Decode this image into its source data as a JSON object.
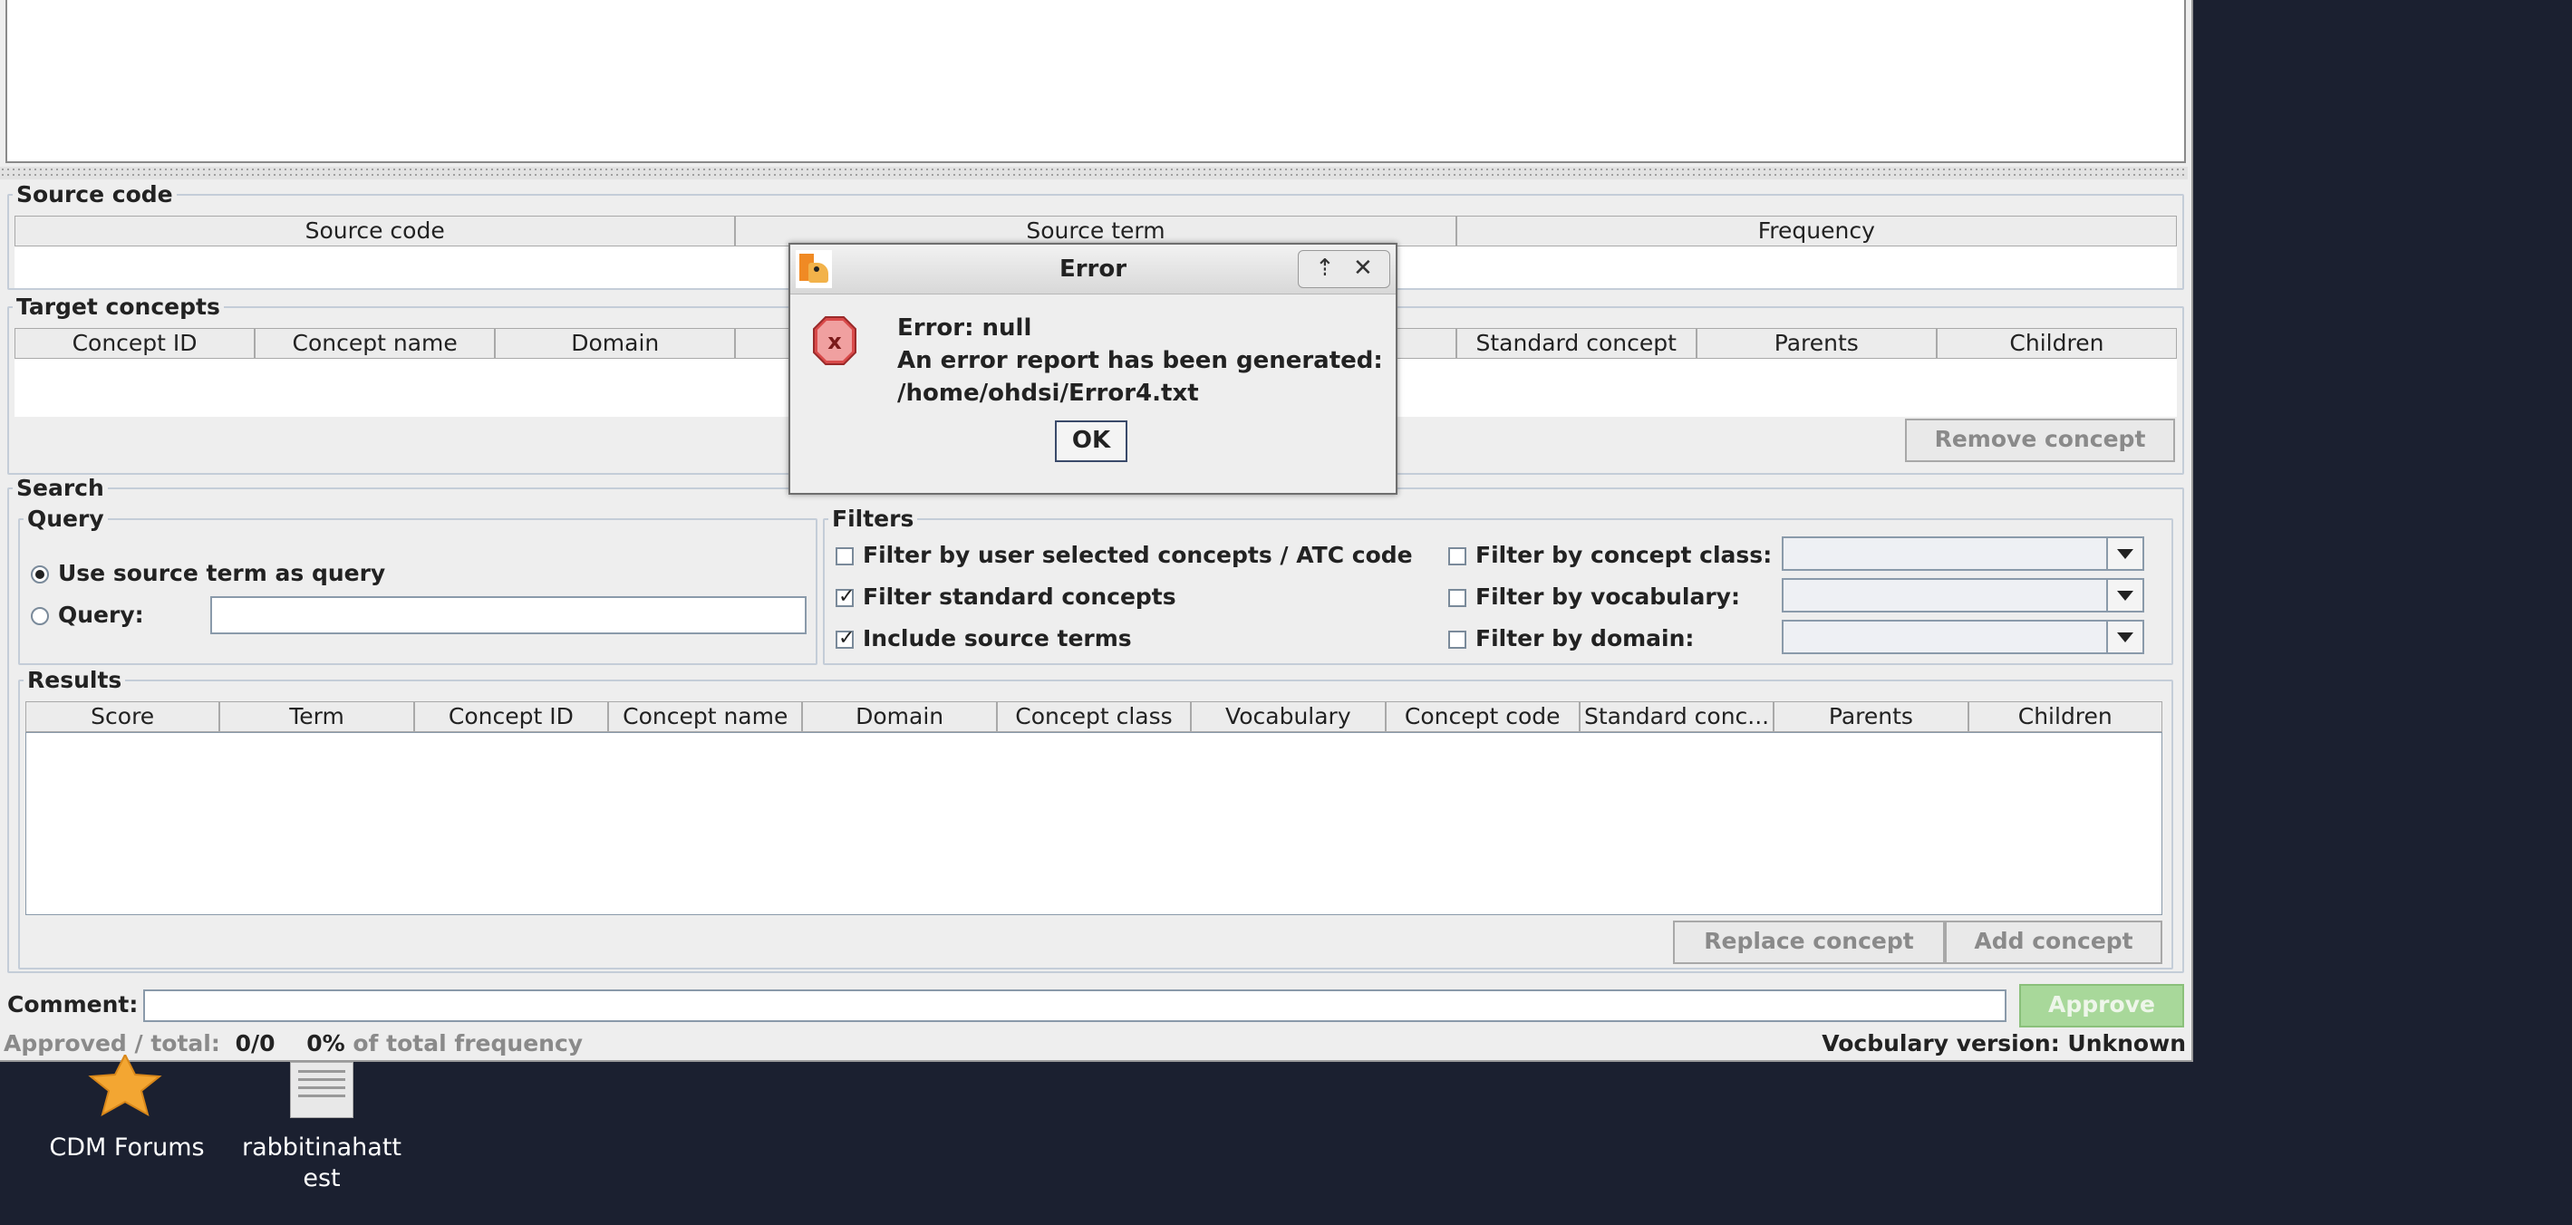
{
  "source_code": {
    "title": "Source code",
    "columns": [
      "Source code",
      "Source term",
      "Frequency"
    ]
  },
  "target_concepts": {
    "title": "Target concepts",
    "columns": [
      "Concept ID",
      "Concept name",
      "Domain",
      "C",
      "",
      "de",
      "Standard concept",
      "Parents",
      "Children"
    ],
    "remove_button": "Remove concept"
  },
  "search": {
    "title": "Search",
    "query": {
      "title": "Query",
      "use_source_label": "Use source term as query",
      "query_label": "Query:",
      "query_value": ""
    },
    "filters": {
      "title": "Filters",
      "user_selected": "Filter by user selected concepts / ATC code",
      "standard": "Filter standard concepts",
      "include_source": "Include source terms",
      "concept_class": "Filter by concept class:",
      "vocabulary": "Filter by vocabulary:",
      "domain": "Filter by domain:"
    },
    "results": {
      "title": "Results",
      "columns": [
        "Score",
        "Term",
        "Concept ID",
        "Concept name",
        "Domain",
        "Concept class",
        "Vocabulary",
        "Concept code",
        "Standard conc...",
        "Parents",
        "Children"
      ],
      "replace_button": "Replace concept",
      "add_button": "Add concept"
    }
  },
  "comment": {
    "label": "Comment:",
    "value": ""
  },
  "approve_button": "Approve",
  "status": {
    "approved_label": "Approved / total:",
    "approved_value": "0/0",
    "percent": "0%",
    "percent_suffix": "of total frequency",
    "vocab_version": "Vocbulary version: Unknown"
  },
  "dialog": {
    "title": "Error",
    "line1": "Error: null",
    "line2": "An error report has been generated:",
    "line3": "/home/ohdsi/Error4.txt",
    "ok": "OK",
    "icon": "error-x-icon"
  },
  "desktop": {
    "icon1_label": "CDM Forums",
    "icon2_label_line1": "rabbitinahatt",
    "icon2_label_line2": "est"
  },
  "colors": {
    "desktop_bg": "#1b2030",
    "window_bg": "#eeeeee",
    "approve_bg": "#a8d89a",
    "error_icon": "#d94a4a"
  }
}
